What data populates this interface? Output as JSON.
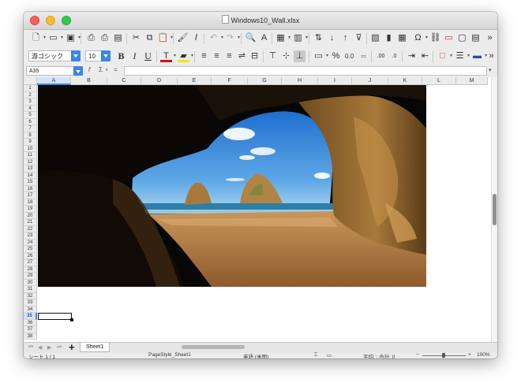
{
  "window": {
    "title": "Windows10_Wall.xlsx"
  },
  "toolbar2": {
    "font_name": "游ゴシック",
    "font_size": "10",
    "bold_label": "B",
    "italic_label": "I",
    "underline_label": "U"
  },
  "formula_bar": {
    "name_box": "A35",
    "fx": "f",
    "sum": "Σ",
    "equals": "=",
    "value": ""
  },
  "columns": [
    "A",
    "B",
    "C",
    "D",
    "E",
    "F",
    "G",
    "H",
    "I",
    "J",
    "K",
    "L",
    "M"
  ],
  "rows": [
    "1",
    "2",
    "3",
    "4",
    "5",
    "6",
    "7",
    "8",
    "9",
    "10",
    "11",
    "12",
    "13",
    "14",
    "15",
    "16",
    "17",
    "18",
    "19",
    "20",
    "21",
    "22",
    "23",
    "24",
    "25",
    "26",
    "27",
    "28",
    "29",
    "30",
    "31",
    "32",
    "33",
    "34",
    "35",
    "36",
    "37",
    "38"
  ],
  "selected": {
    "column": "A",
    "row": "35"
  },
  "sheets": {
    "tabs": [
      "Sheet1"
    ],
    "active": "Sheet1",
    "add": "+"
  },
  "status": {
    "sheet": "シート 1 / 1",
    "page_style": "PageStyle_Sheet1",
    "language": "英語 (米国)",
    "stats": "平均: ; 合計: 0",
    "zoom": "100%",
    "zoom_minus": "−",
    "zoom_plus": "+"
  },
  "icons": {
    "accent_blue": "#3b84e8",
    "selection_color": "#d3e2f6"
  }
}
